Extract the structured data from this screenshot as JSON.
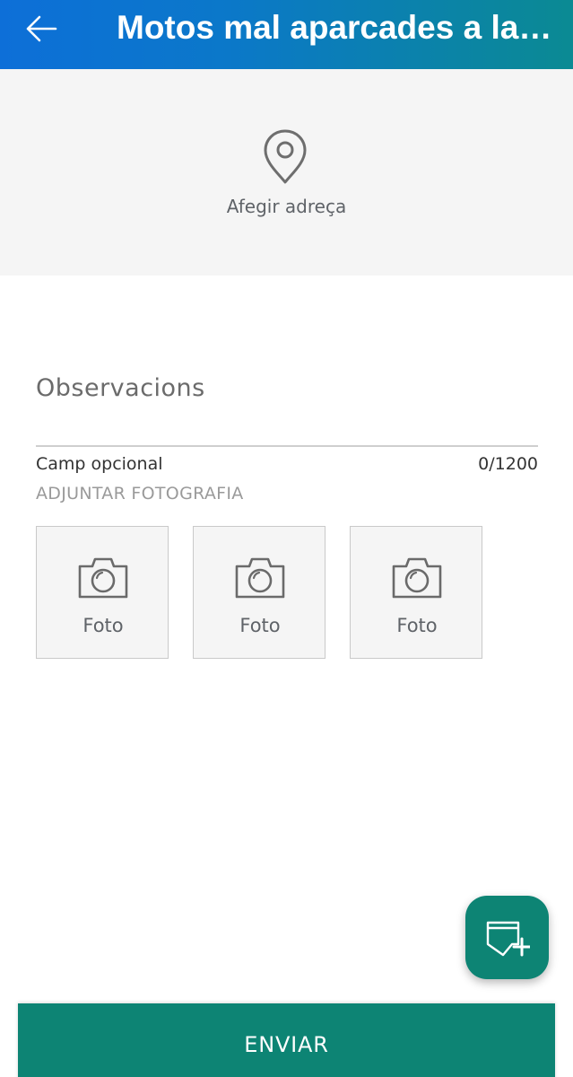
{
  "header": {
    "title": "Motos mal aparcades a la vorera",
    "back_icon": "arrow-left-icon",
    "gradient_start": "#0d6fd8",
    "gradient_end": "#0b8a93"
  },
  "address": {
    "icon": "map-pin-icon",
    "label": "Afegir adreça"
  },
  "observations": {
    "placeholder": "Observacions",
    "value": "",
    "helper": "Camp opcional",
    "counter": "0/1200"
  },
  "attachments": {
    "title": "ADJUNTAR FOTOGRAFIA",
    "slots": [
      {
        "icon": "camera-icon",
        "label": "Foto"
      },
      {
        "icon": "camera-icon",
        "label": "Foto"
      },
      {
        "icon": "camera-icon",
        "label": "Foto"
      }
    ]
  },
  "fab": {
    "icon": "add-ticket-icon",
    "color": "#0d8474"
  },
  "send": {
    "label": "ENVIAR",
    "color": "#0d8474"
  }
}
